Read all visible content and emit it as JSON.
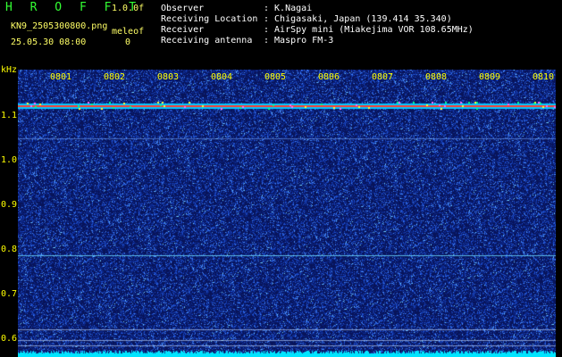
{
  "header": {
    "program": "H R O F F T",
    "version": "1.0.0f",
    "filename": "KN9_2505300800.png",
    "mode_label": "meleof",
    "datetime": "25.05.30 08:00",
    "counter": "0",
    "info": [
      {
        "label": "Observer",
        "value": ": K.Nagai"
      },
      {
        "label": "Receiving Location",
        "value": ": Chigasaki, Japan (139.414 35.340)"
      },
      {
        "label": "Receiver",
        "value": ": AirSpy mini (Miakejima VOR 108.65MHz)"
      },
      {
        "label": "Receiving antenna",
        "value": ": Maspro FM-3"
      }
    ]
  },
  "axes": {
    "y_unit": "kHz",
    "y_ticks": [
      "1.1",
      "1.0",
      "0.9",
      "0.8",
      "0.7",
      "0.6"
    ],
    "x_ticks": [
      "0801",
      "0802",
      "0803",
      "0804",
      "0805",
      "0806",
      "0807",
      "0808",
      "0809",
      "0810"
    ]
  },
  "colors": {
    "background": "#000000",
    "noise_dark": "#0a1e6e",
    "noise_light": "#2f6cff",
    "carrier": "#ff3b30",
    "baseline": "#00e5ff",
    "tick_text": "#ffff00"
  }
}
